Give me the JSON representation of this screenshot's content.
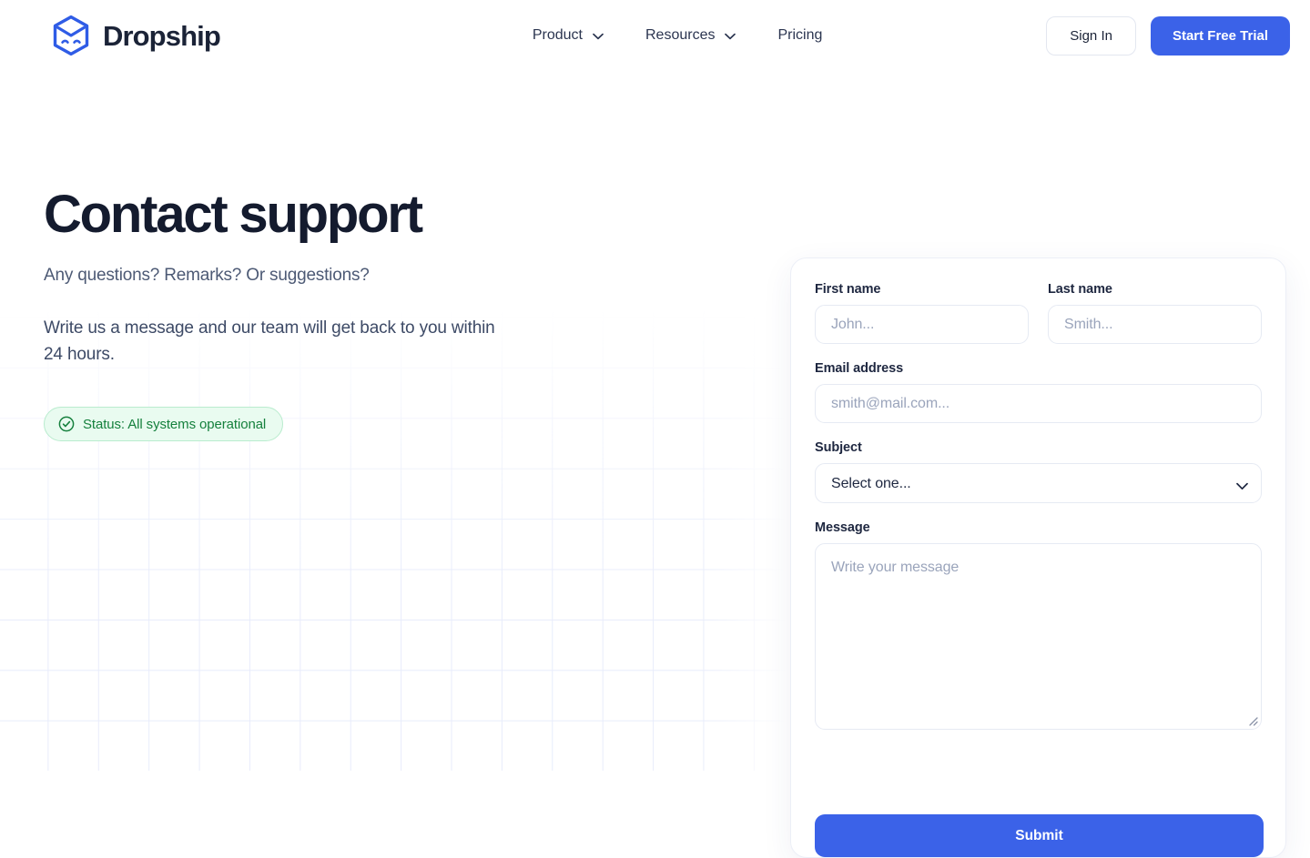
{
  "brand": {
    "name": "Dropship",
    "logo_icon": "dropship-hexagon-box-logo",
    "logo_color": "#2f5ce6",
    "name_color": "#1b2337"
  },
  "nav": {
    "items": [
      {
        "label": "Product",
        "has_dropdown": true,
        "icon": "chevron-down-icon"
      },
      {
        "label": "Resources",
        "has_dropdown": true,
        "icon": "chevron-down-icon"
      },
      {
        "label": "Pricing",
        "has_dropdown": false,
        "icon": ""
      }
    ]
  },
  "header_actions": {
    "sign_in_label": "Sign In",
    "start_trial_label": "Start Free Trial",
    "accent_color": "#3b62e8"
  },
  "intro": {
    "title": "Contact support",
    "subtitle": "Any questions? Remarks? Or suggestions?",
    "lede": "Write us a message and our team will get back to you within 24 hours.",
    "status": {
      "text": "Status: All systems operational",
      "icon": "check-circle-icon",
      "text_color": "#15803d",
      "background_color": "#e9fbf0",
      "border_color": "#b9ecce"
    }
  },
  "form": {
    "first_name": {
      "label": "First name",
      "placeholder": "John...",
      "value": ""
    },
    "last_name": {
      "label": "Last name",
      "placeholder": "Smith...",
      "value": ""
    },
    "email": {
      "label": "Email address",
      "placeholder": "smith@mail.com...",
      "value": ""
    },
    "subject": {
      "label": "Subject",
      "selected": "Select one...",
      "icon": "chevron-down-icon",
      "options": [
        "Select one..."
      ]
    },
    "message": {
      "label": "Message",
      "placeholder": "Write your message",
      "value": "",
      "resize_handle_icon": "resize-grip-icon"
    },
    "submit_label": "Submit"
  }
}
